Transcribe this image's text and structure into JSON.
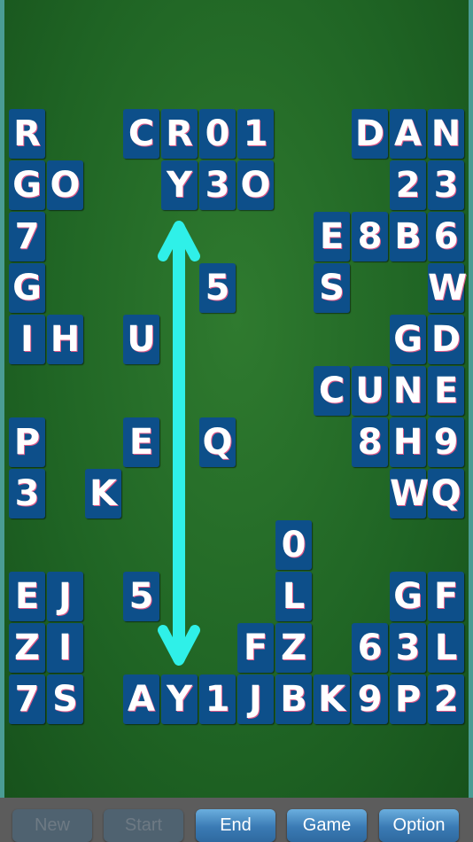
{
  "board": {
    "grid_columns": 12,
    "grid_rows": 12,
    "tiles": [
      {
        "r": 0,
        "c": 0,
        "t": "R"
      },
      {
        "r": 0,
        "c": 3,
        "t": "C"
      },
      {
        "r": 0,
        "c": 4,
        "t": "R"
      },
      {
        "r": 0,
        "c": 5,
        "t": "0"
      },
      {
        "r": 0,
        "c": 6,
        "t": "1"
      },
      {
        "r": 0,
        "c": 9,
        "t": "D"
      },
      {
        "r": 0,
        "c": 10,
        "t": "A"
      },
      {
        "r": 0,
        "c": 11,
        "t": "N"
      },
      {
        "r": 1,
        "c": 0,
        "t": "G"
      },
      {
        "r": 1,
        "c": 1,
        "t": "O"
      },
      {
        "r": 1,
        "c": 4,
        "t": "Y"
      },
      {
        "r": 1,
        "c": 5,
        "t": "3"
      },
      {
        "r": 1,
        "c": 6,
        "t": "O"
      },
      {
        "r": 1,
        "c": 10,
        "t": "2"
      },
      {
        "r": 1,
        "c": 11,
        "t": "3"
      },
      {
        "r": 2,
        "c": 0,
        "t": "7"
      },
      {
        "r": 2,
        "c": 8,
        "t": "E"
      },
      {
        "r": 2,
        "c": 9,
        "t": "8"
      },
      {
        "r": 2,
        "c": 10,
        "t": "B"
      },
      {
        "r": 2,
        "c": 11,
        "t": "6"
      },
      {
        "r": 3,
        "c": 0,
        "t": "G"
      },
      {
        "r": 3,
        "c": 5,
        "t": "5"
      },
      {
        "r": 3,
        "c": 8,
        "t": "S"
      },
      {
        "r": 3,
        "c": 11,
        "t": "W"
      },
      {
        "r": 4,
        "c": 0,
        "t": "I"
      },
      {
        "r": 4,
        "c": 1,
        "t": "H"
      },
      {
        "r": 4,
        "c": 3,
        "t": "U"
      },
      {
        "r": 4,
        "c": 10,
        "t": "G"
      },
      {
        "r": 4,
        "c": 11,
        "t": "D"
      },
      {
        "r": 5,
        "c": 8,
        "t": "C"
      },
      {
        "r": 5,
        "c": 9,
        "t": "U"
      },
      {
        "r": 5,
        "c": 10,
        "t": "N"
      },
      {
        "r": 5,
        "c": 11,
        "t": "E"
      },
      {
        "r": 6,
        "c": 0,
        "t": "P"
      },
      {
        "r": 6,
        "c": 3,
        "t": "E"
      },
      {
        "r": 6,
        "c": 5,
        "t": "Q"
      },
      {
        "r": 6,
        "c": 9,
        "t": "8"
      },
      {
        "r": 6,
        "c": 10,
        "t": "H"
      },
      {
        "r": 6,
        "c": 11,
        "t": "9"
      },
      {
        "r": 7,
        "c": 0,
        "t": "3"
      },
      {
        "r": 7,
        "c": 2,
        "t": "K"
      },
      {
        "r": 7,
        "c": 10,
        "t": "W"
      },
      {
        "r": 7,
        "c": 11,
        "t": "Q"
      },
      {
        "r": 8,
        "c": 7,
        "t": "0"
      },
      {
        "r": 9,
        "c": 0,
        "t": "E"
      },
      {
        "r": 9,
        "c": 1,
        "t": "J"
      },
      {
        "r": 9,
        "c": 3,
        "t": "5"
      },
      {
        "r": 9,
        "c": 7,
        "t": "L"
      },
      {
        "r": 9,
        "c": 10,
        "t": "G"
      },
      {
        "r": 9,
        "c": 11,
        "t": "F"
      },
      {
        "r": 10,
        "c": 0,
        "t": "Z"
      },
      {
        "r": 10,
        "c": 1,
        "t": "I"
      },
      {
        "r": 10,
        "c": 6,
        "t": "F"
      },
      {
        "r": 10,
        "c": 7,
        "t": "Z"
      },
      {
        "r": 10,
        "c": 9,
        "t": "6"
      },
      {
        "r": 10,
        "c": 10,
        "t": "3"
      },
      {
        "r": 10,
        "c": 11,
        "t": "L"
      },
      {
        "r": 11,
        "c": 0,
        "t": "7"
      },
      {
        "r": 11,
        "c": 1,
        "t": "S"
      },
      {
        "r": 11,
        "c": 3,
        "t": "A"
      },
      {
        "r": 11,
        "c": 4,
        "t": "Y"
      },
      {
        "r": 11,
        "c": 5,
        "t": "1"
      },
      {
        "r": 11,
        "c": 6,
        "t": "J"
      },
      {
        "r": 11,
        "c": 7,
        "t": "B"
      },
      {
        "r": 11,
        "c": 8,
        "t": "K"
      },
      {
        "r": 11,
        "c": 9,
        "t": "9"
      },
      {
        "r": 11,
        "c": 10,
        "t": "P"
      },
      {
        "r": 11,
        "c": 11,
        "t": "2"
      }
    ],
    "hint_arrow": {
      "icon": "double-arrow-vertical",
      "color": "#2ff0e8",
      "column": 4,
      "from_row": 2,
      "to_row": 10
    }
  },
  "toolbar": {
    "buttons": [
      {
        "label": "New",
        "enabled": false
      },
      {
        "label": "Start",
        "enabled": false
      },
      {
        "label": "End",
        "enabled": true
      },
      {
        "label": "Game",
        "enabled": true
      },
      {
        "label": "Option",
        "enabled": true
      }
    ]
  },
  "colors": {
    "tile": "#0d4f8a",
    "felt": "#1f6424",
    "accent": "#2ff0e8"
  }
}
